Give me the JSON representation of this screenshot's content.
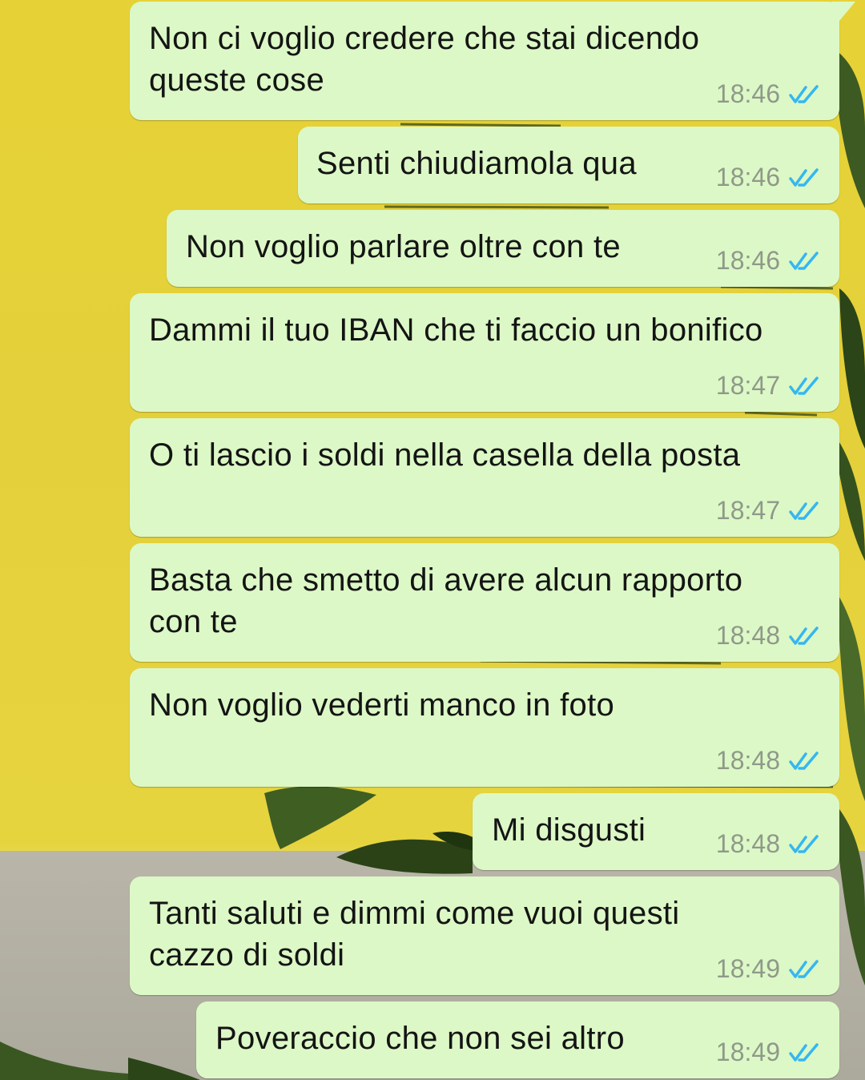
{
  "chat": {
    "messages": [
      {
        "text": "Non ci voglio credere che stai dicendo\nqueste cose",
        "time": "18:46",
        "status": "read"
      },
      {
        "text": "Senti chiudiamola qua",
        "time": "18:46",
        "status": "read"
      },
      {
        "text": "Non voglio parlare oltre con te",
        "time": "18:46",
        "status": "read"
      },
      {
        "text": "Dammi il tuo IBAN che ti faccio un bonifico",
        "time": "18:47",
        "status": "read"
      },
      {
        "text": "O ti lascio i soldi nella casella della posta",
        "time": "18:47",
        "status": "read"
      },
      {
        "text": "Basta che smetto di avere alcun rapporto\ncon te",
        "time": "18:48",
        "status": "read"
      },
      {
        "text": "Non voglio vederti manco in foto",
        "time": "18:48",
        "status": "read"
      },
      {
        "text": "Mi disgusti",
        "time": "18:48",
        "status": "read"
      },
      {
        "text": "Tanti saluti e dimmi come vuoi questi\ncazzo di soldi",
        "time": "18:49",
        "status": "read"
      },
      {
        "text": "Poveraccio che non sei altro",
        "time": "18:49",
        "status": "read"
      }
    ]
  },
  "colors": {
    "bubble": "#dcf8c6",
    "read_ticks": "#34b7f1",
    "time": "#8f998a",
    "wallpaper_yellow": "#e6d236"
  },
  "icons": {
    "read_status": "double-check-icon"
  }
}
